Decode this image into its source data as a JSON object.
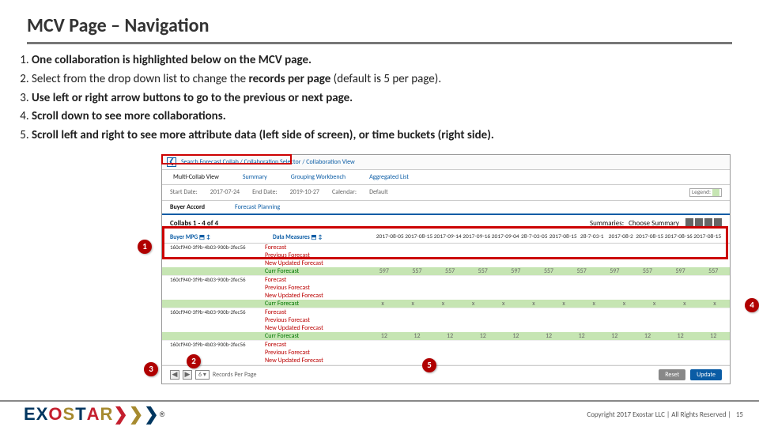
{
  "title": "MCV Page – Navigation",
  "bullets": [
    "One collaboration is highlighted below on the MCV page.",
    "Select from the drop down list to change the records per page (default is 5 per page).",
    "Use left or right arrow buttons to go to the previous or next page.",
    "Scroll down to see more collaborations.",
    "Scroll left and right to see more attribute data (left side of screen), or time buckets (right side)."
  ],
  "shot": {
    "breadcrumb": "Search Forecast Collab / Collaboration Selector / Collaboration View",
    "tabs": [
      "Multi-Collab View",
      "Summary",
      "Grouping Workbench",
      "Aggregated List"
    ],
    "filters": {
      "start_label": "Start Date:",
      "start_val": "2017-07-24",
      "end_label": "End Date:",
      "end_val": "2019-10-27",
      "cal_label": "Calendar:",
      "cal_val": "Default",
      "legend": "Legend:"
    },
    "subtabs": [
      "Buyer Accord",
      "Forecast Planning"
    ],
    "collab_title": "Collabs 1 - 4 of 4",
    "summaries": "Summaries:",
    "choose": "Choose Summary",
    "h1": "Buyer MPG",
    "h2": "Data Measures",
    "dates": [
      "2017-08-05",
      "2017-08-15",
      "2017-09-14",
      "2017-09-16",
      "2017-09-04",
      "28-7-03-05",
      "2017-08-15",
      "28-7-03-1",
      "2017-08-2",
      "2017-08-15",
      "2017-08-16",
      "2017-08-15"
    ],
    "id1": "160cf940-3f9b-4b03-900b-2fec56",
    "metrics": [
      "Forecast",
      "Previous Forecast",
      "New Updated Forecast",
      "Curr Forecast"
    ],
    "row_vals_597": [
      "597",
      "557",
      "557",
      "557",
      "597",
      "557",
      "557",
      "597",
      "557",
      "597",
      "557"
    ],
    "row_vals_x": [
      "x",
      "x",
      "x",
      "x",
      "x",
      "x",
      "x",
      "x",
      "x",
      "x",
      "x",
      "x"
    ],
    "row_vals_12": [
      "12",
      "12",
      "12",
      "12",
      "12",
      "12",
      "12",
      "12",
      "12",
      "12",
      "12"
    ],
    "footer": {
      "sel": "6",
      "label": "Records Per Page",
      "btn1": "Reset",
      "btn2": "Update"
    }
  },
  "copyright": "Copyright 2017 Exostar LLC | All Rights Reserved |",
  "page_num": "15",
  "logo_text": "EXOSTAR"
}
